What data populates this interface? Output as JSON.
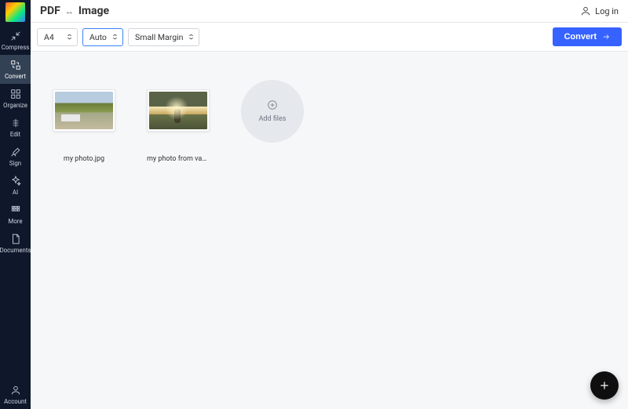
{
  "header": {
    "title_left": "PDF",
    "title_right": "Image",
    "login_label": "Log in"
  },
  "sidebar": {
    "items": [
      {
        "label": "Compress"
      },
      {
        "label": "Convert"
      },
      {
        "label": "Organize"
      },
      {
        "label": "Edit"
      },
      {
        "label": "Sign"
      },
      {
        "label": "AI"
      },
      {
        "label": "More"
      },
      {
        "label": "Documents"
      }
    ],
    "account_label": "Account"
  },
  "toolbar": {
    "page_size": "A4",
    "orientation": "Auto",
    "margin": "Small Margin",
    "convert_label": "Convert"
  },
  "workspace": {
    "files": [
      {
        "name": "my photo.jpg"
      },
      {
        "name": "my photo from vacati…"
      }
    ],
    "add_files_label": "Add files"
  }
}
